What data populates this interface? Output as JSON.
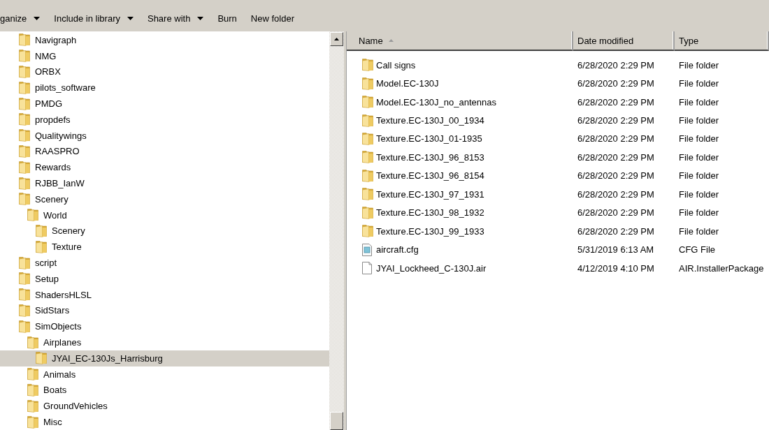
{
  "toolbar": {
    "items": [
      {
        "label": "ganize",
        "dropdown": true
      },
      {
        "label": "Include in library",
        "dropdown": true
      },
      {
        "label": "Share with",
        "dropdown": true
      },
      {
        "label": "Burn",
        "dropdown": false
      },
      {
        "label": "New folder",
        "dropdown": false
      }
    ]
  },
  "navigation_tree": {
    "items": [
      {
        "label": "Navigraph",
        "selected": false
      },
      {
        "label": "NMG",
        "selected": false
      },
      {
        "label": "ORBX",
        "selected": false
      },
      {
        "label": "pilots_software",
        "selected": false
      },
      {
        "label": "PMDG",
        "selected": false
      },
      {
        "label": "propdefs",
        "selected": false
      },
      {
        "label": "Qualitywings",
        "selected": false
      },
      {
        "label": "RAASPRO",
        "selected": false
      },
      {
        "label": "Rewards",
        "selected": false
      },
      {
        "label": "RJBB_IanW",
        "selected": false
      },
      {
        "label": "Scenery",
        "selected": false,
        "children": [
          {
            "label": "World",
            "selected": false,
            "children": [
              {
                "label": "Scenery",
                "selected": false
              },
              {
                "label": "Texture",
                "selected": false
              }
            ]
          }
        ]
      },
      {
        "label": "script",
        "selected": false
      },
      {
        "label": "Setup",
        "selected": false
      },
      {
        "label": "ShadersHLSL",
        "selected": false
      },
      {
        "label": "SidStars",
        "selected": false
      },
      {
        "label": "SimObjects",
        "selected": false,
        "children": [
          {
            "label": "Airplanes",
            "selected": false,
            "children": [
              {
                "label": "JYAI_EC-130Js_Harrisburg",
                "selected": true
              }
            ]
          },
          {
            "label": "Animals",
            "selected": false
          },
          {
            "label": "Boats",
            "selected": false
          },
          {
            "label": "GroundVehicles",
            "selected": false
          },
          {
            "label": "Misc",
            "selected": false
          }
        ]
      }
    ]
  },
  "file_list": {
    "columns": [
      {
        "label": "Name",
        "sorted": true
      },
      {
        "label": "Date modified",
        "sorted": false
      },
      {
        "label": "Type",
        "sorted": false
      }
    ],
    "rows": [
      {
        "kind": "folder",
        "name": "Call signs",
        "date_modified": "6/28/2020 2:29 PM",
        "type": "File folder"
      },
      {
        "kind": "folder",
        "name": "Model.EC-130J",
        "date_modified": "6/28/2020 2:29 PM",
        "type": "File folder"
      },
      {
        "kind": "folder",
        "name": "Model.EC-130J_no_antennas",
        "date_modified": "6/28/2020 2:29 PM",
        "type": "File folder"
      },
      {
        "kind": "folder",
        "name": "Texture.EC-130J_00_1934",
        "date_modified": "6/28/2020 2:29 PM",
        "type": "File folder"
      },
      {
        "kind": "folder",
        "name": "Texture.EC-130J_01-1935",
        "date_modified": "6/28/2020 2:29 PM",
        "type": "File folder"
      },
      {
        "kind": "folder",
        "name": "Texture.EC-130J_96_8153",
        "date_modified": "6/28/2020 2:29 PM",
        "type": "File folder"
      },
      {
        "kind": "folder",
        "name": "Texture.EC-130J_96_8154",
        "date_modified": "6/28/2020 2:29 PM",
        "type": "File folder"
      },
      {
        "kind": "folder",
        "name": "Texture.EC-130J_97_1931",
        "date_modified": "6/28/2020 2:29 PM",
        "type": "File folder"
      },
      {
        "kind": "folder",
        "name": "Texture.EC-130J_98_1932",
        "date_modified": "6/28/2020 2:29 PM",
        "type": "File folder"
      },
      {
        "kind": "folder",
        "name": "Texture.EC-130J_99_1933",
        "date_modified": "6/28/2020 2:29 PM",
        "type": "File folder"
      },
      {
        "kind": "config",
        "name": "aircraft.cfg",
        "date_modified": "5/31/2019 6:13 AM",
        "type": "CFG File"
      },
      {
        "kind": "file",
        "name": "JYAI_Lockheed_C-130J.air",
        "date_modified": "4/12/2019 4:10 PM",
        "type": "AIR.InstallerPackage"
      }
    ]
  }
}
